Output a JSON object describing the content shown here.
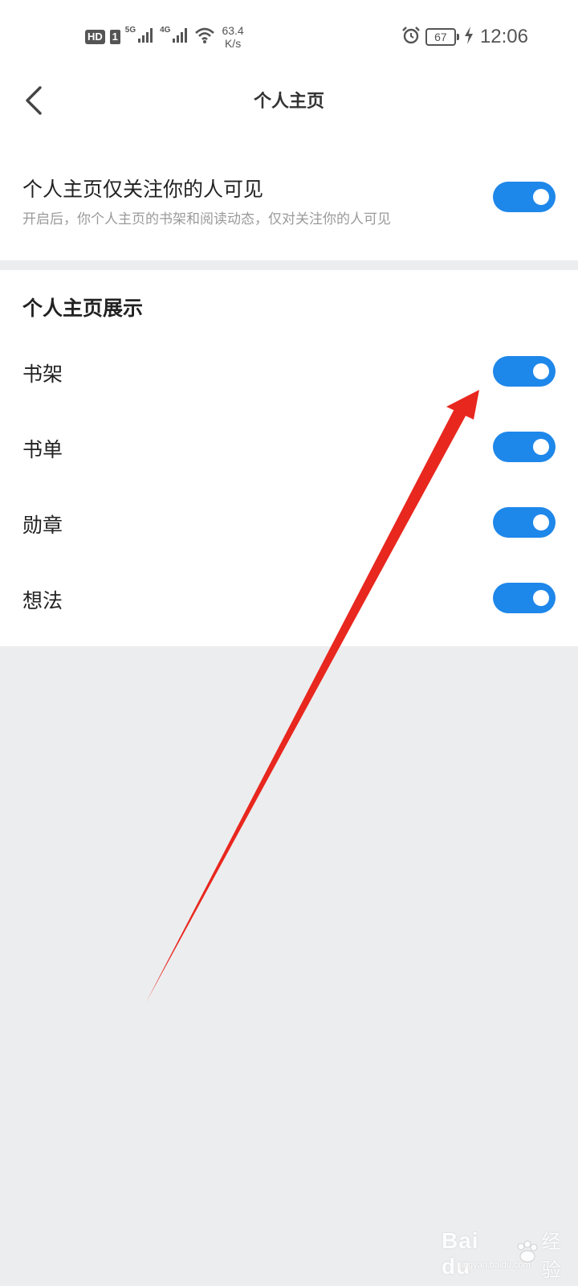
{
  "status_bar": {
    "hd": "HD",
    "sim": "1",
    "net1": "5G",
    "net2": "4G",
    "speed_value": "63.4",
    "speed_unit": "K/s",
    "battery": "67",
    "time": "12:06"
  },
  "header": {
    "title": "个人主页"
  },
  "privacy": {
    "title": "个人主页仅关注你的人可见",
    "description": "开启后，你个人主页的书架和阅读动态，仅对关注你的人可见",
    "enabled": true
  },
  "display_section": {
    "title": "个人主页展示",
    "items": [
      {
        "label": "书架",
        "enabled": true
      },
      {
        "label": "书单",
        "enabled": true
      },
      {
        "label": "勋章",
        "enabled": true
      },
      {
        "label": "想法",
        "enabled": true
      }
    ]
  },
  "colors": {
    "toggle_on": "#1e87ea",
    "annotation_arrow": "#e8271e",
    "page_background": "#ecedef"
  },
  "watermark": {
    "brand": "Bai du",
    "product": "经验",
    "url": "jingyan.baidu.com"
  }
}
